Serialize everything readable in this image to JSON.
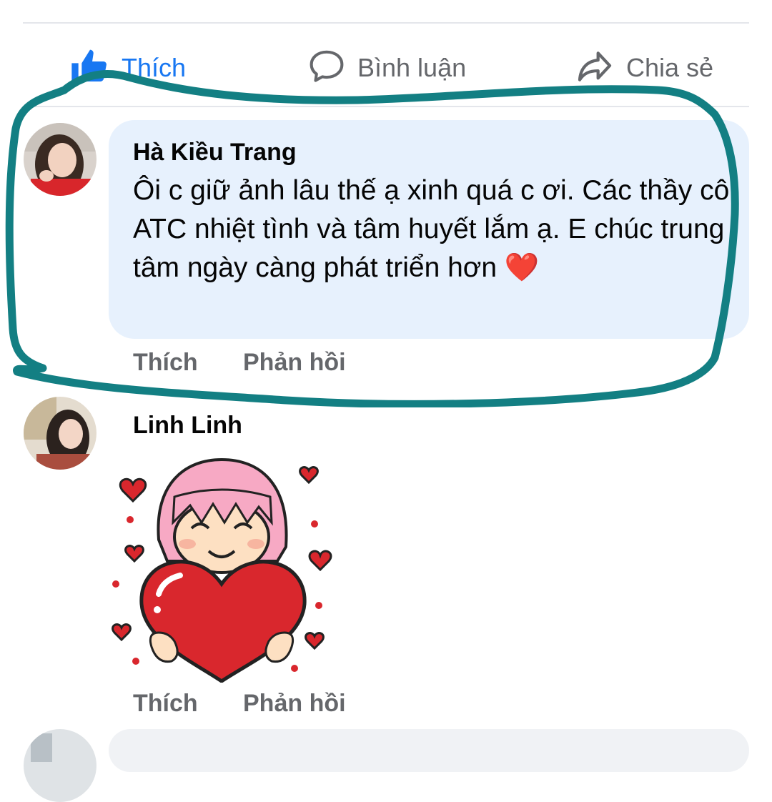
{
  "actions": {
    "like_label": "Thích",
    "comment_label": "Bình luận",
    "share_label": "Chia sẻ"
  },
  "comments": [
    {
      "author": "Hà Kiều Trang",
      "text": "Ôi c giữ ảnh lâu thế ạ xinh quá c ơi. Các thầy cô ATC nhiệt tình và tâm huyết lắm ạ. E chúc trung tâm ngày càng phát triển hơn ❤️",
      "like_label": "Thích",
      "reply_label": "Phản hồi"
    },
    {
      "author": "Linh Linh",
      "sticker": "girl-hugging-heart-sticker",
      "like_label": "Thích",
      "reply_label": "Phản hồi"
    }
  ],
  "colors": {
    "brand_blue": "#1877f2",
    "highlight_teal": "#137f83",
    "bubble_blue": "#e7f1fd"
  }
}
